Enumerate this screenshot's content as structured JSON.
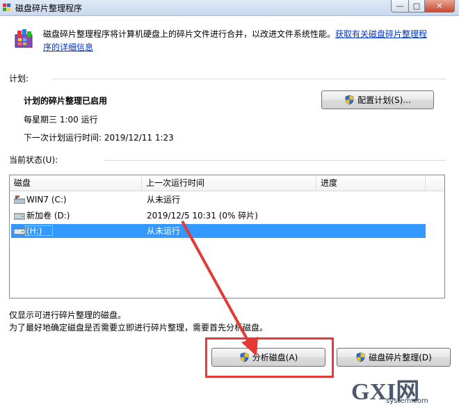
{
  "window": {
    "title": "磁盘碎片整理程序",
    "buttons": {
      "min": "—",
      "max": "□",
      "close": "✕"
    }
  },
  "intro": {
    "text": "磁盘碎片整理程序将计算机硬盘上的碎片文件进行合并，以改进文件系统性能。",
    "link_line1": "获取有关磁盘碎片整理程",
    "link_line2": "序的详细信息"
  },
  "schedule": {
    "label": "计划:",
    "status": "计划的碎片整理已启用",
    "frequency": "每星期三  1:00 运行",
    "next_run": "下一次计划运行时间: 2019/12/11 1:23",
    "configure_button": "配置计划(S)..."
  },
  "current_status": {
    "label": "当前状态(U):",
    "columns": [
      "磁盘",
      "上一次运行时间",
      "进度"
    ],
    "rows": [
      {
        "disk": "WIN7 (C:)",
        "last_run": "从未运行",
        "progress": "",
        "icon": "system-drive-icon"
      },
      {
        "disk": "新加卷 (D:)",
        "last_run": "2019/12/5 10:31 (0% 碎片)",
        "progress": "",
        "icon": "drive-icon"
      },
      {
        "disk": "(H:)",
        "last_run": "从未运行",
        "progress": "",
        "icon": "drive-icon",
        "selected": true
      }
    ]
  },
  "footer": {
    "note1": "仅显示可进行碎片整理的磁盘。",
    "note2": "为了最好地确定磁盘是否需要立即进行碎片整理，需要首先分析磁盘。"
  },
  "actions": {
    "analyze": "分析磁盘(A)",
    "defrag": "磁盘碎片整理(D)"
  },
  "watermark": {
    "big": "GXI网",
    "small": "system.com"
  },
  "colors": {
    "selection": "#3399ff",
    "annotation": "#e53935",
    "link": "#0033cc"
  }
}
